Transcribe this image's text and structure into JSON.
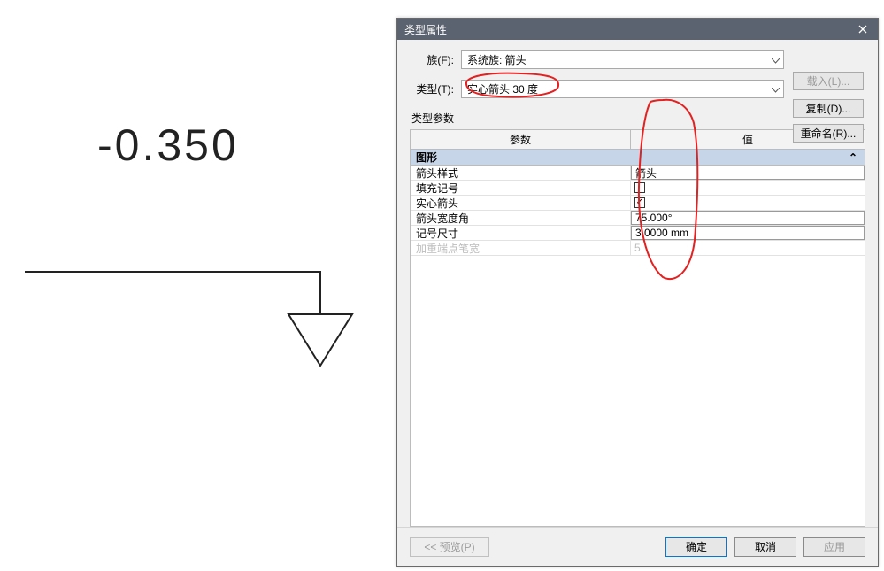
{
  "stage": {
    "value_text": "-0.350"
  },
  "dialog": {
    "title": "类型属性",
    "close_glyph": "×",
    "family_label": "族(F):",
    "family_value": "系统族: 箭头",
    "type_label": "类型(T):",
    "type_value": "实心箭头 30 度",
    "buttons": {
      "load": "载入(L)...",
      "duplicate": "复制(D)...",
      "rename": "重命名(R)..."
    },
    "params_section": "类型参数",
    "table": {
      "header_param": "参数",
      "header_value": "值",
      "group": "图形",
      "collapse_glyph": "⌃",
      "rows": [
        {
          "param": "箭头样式",
          "value": "箭头",
          "kind": "text"
        },
        {
          "param": "填充记号",
          "value": "",
          "kind": "check",
          "checked": false
        },
        {
          "param": "实心箭头",
          "value": "",
          "kind": "check",
          "checked": true
        },
        {
          "param": "箭头宽度角",
          "value": "75.000°",
          "kind": "text"
        },
        {
          "param": "记号尺寸",
          "value": "3.0000 mm",
          "kind": "text"
        },
        {
          "param": "加重端点笔宽",
          "value": "5",
          "kind": "text",
          "disabled": true
        }
      ]
    },
    "footer": {
      "preview": "<< 预览(P)",
      "ok": "确定",
      "cancel": "取消",
      "apply": "应用"
    }
  }
}
